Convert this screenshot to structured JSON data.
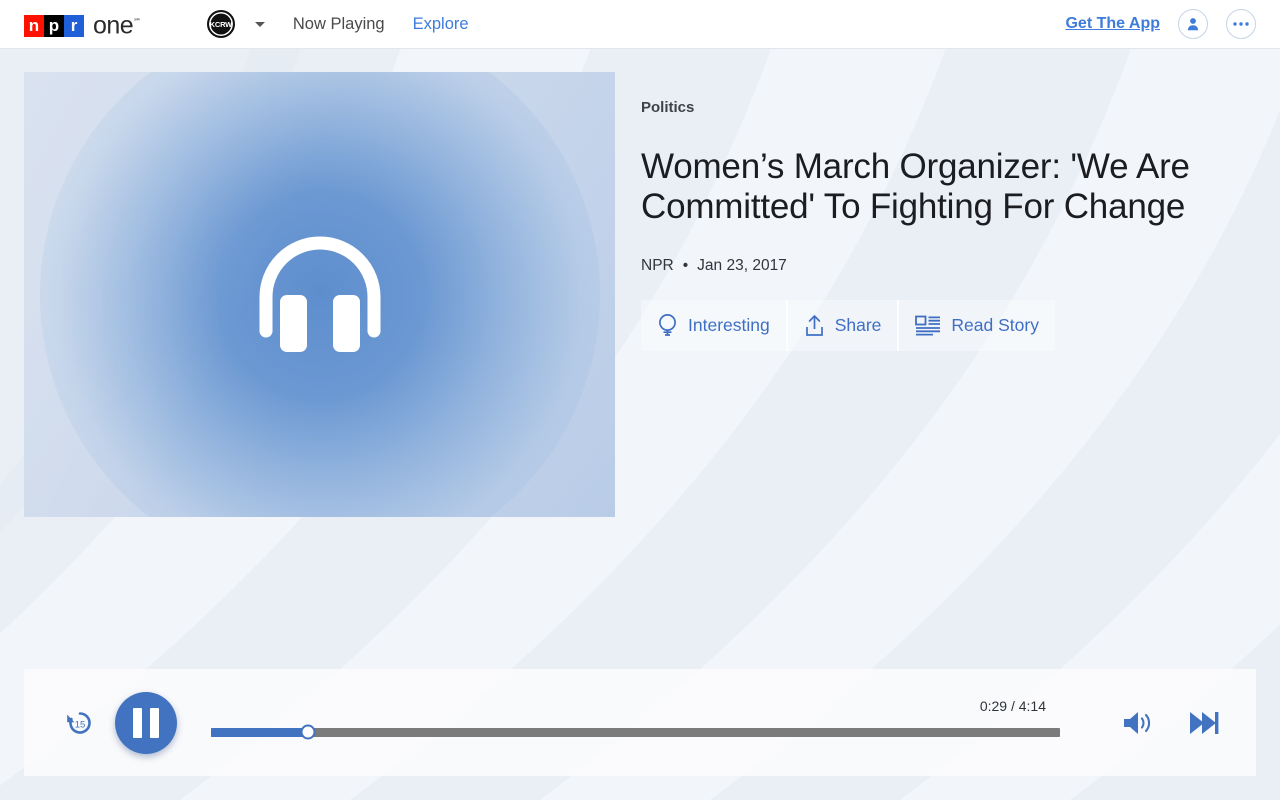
{
  "header": {
    "brand": {
      "npr_n": "n",
      "npr_p": "p",
      "npr_r": "r",
      "word": "one",
      "tm": "℠"
    },
    "station": {
      "name": "KCRW"
    },
    "nav": [
      {
        "label": "Now Playing",
        "style": "active"
      },
      {
        "label": "Explore",
        "style": "link"
      }
    ],
    "get_app_label": "Get The App"
  },
  "now_playing": {
    "kicker": "Politics",
    "headline": "Women’s March Organizer: 'We Are Committed' To Fighting For Change",
    "source": "NPR",
    "separator": "•",
    "date": "Jan 23, 2017",
    "actions": [
      {
        "label": "Interesting",
        "icon": "lightbulb-icon"
      },
      {
        "label": "Share",
        "icon": "share-upload-icon"
      },
      {
        "label": "Read Story",
        "icon": "read-story-icon"
      }
    ]
  },
  "player": {
    "rewind_seconds": "15",
    "state": "playing",
    "current_time": "0:29",
    "total_time": "4:14",
    "time_display": "0:29 / 4:14",
    "progress_percent": 11.4
  },
  "colors": {
    "accent_blue": "#4273c0",
    "link_blue": "#3d7cdb",
    "npr_red": "#ff1100",
    "npr_blue": "#1f5fd8",
    "track_gray": "#7b7b7b",
    "page_bg": "#eef2f7"
  }
}
